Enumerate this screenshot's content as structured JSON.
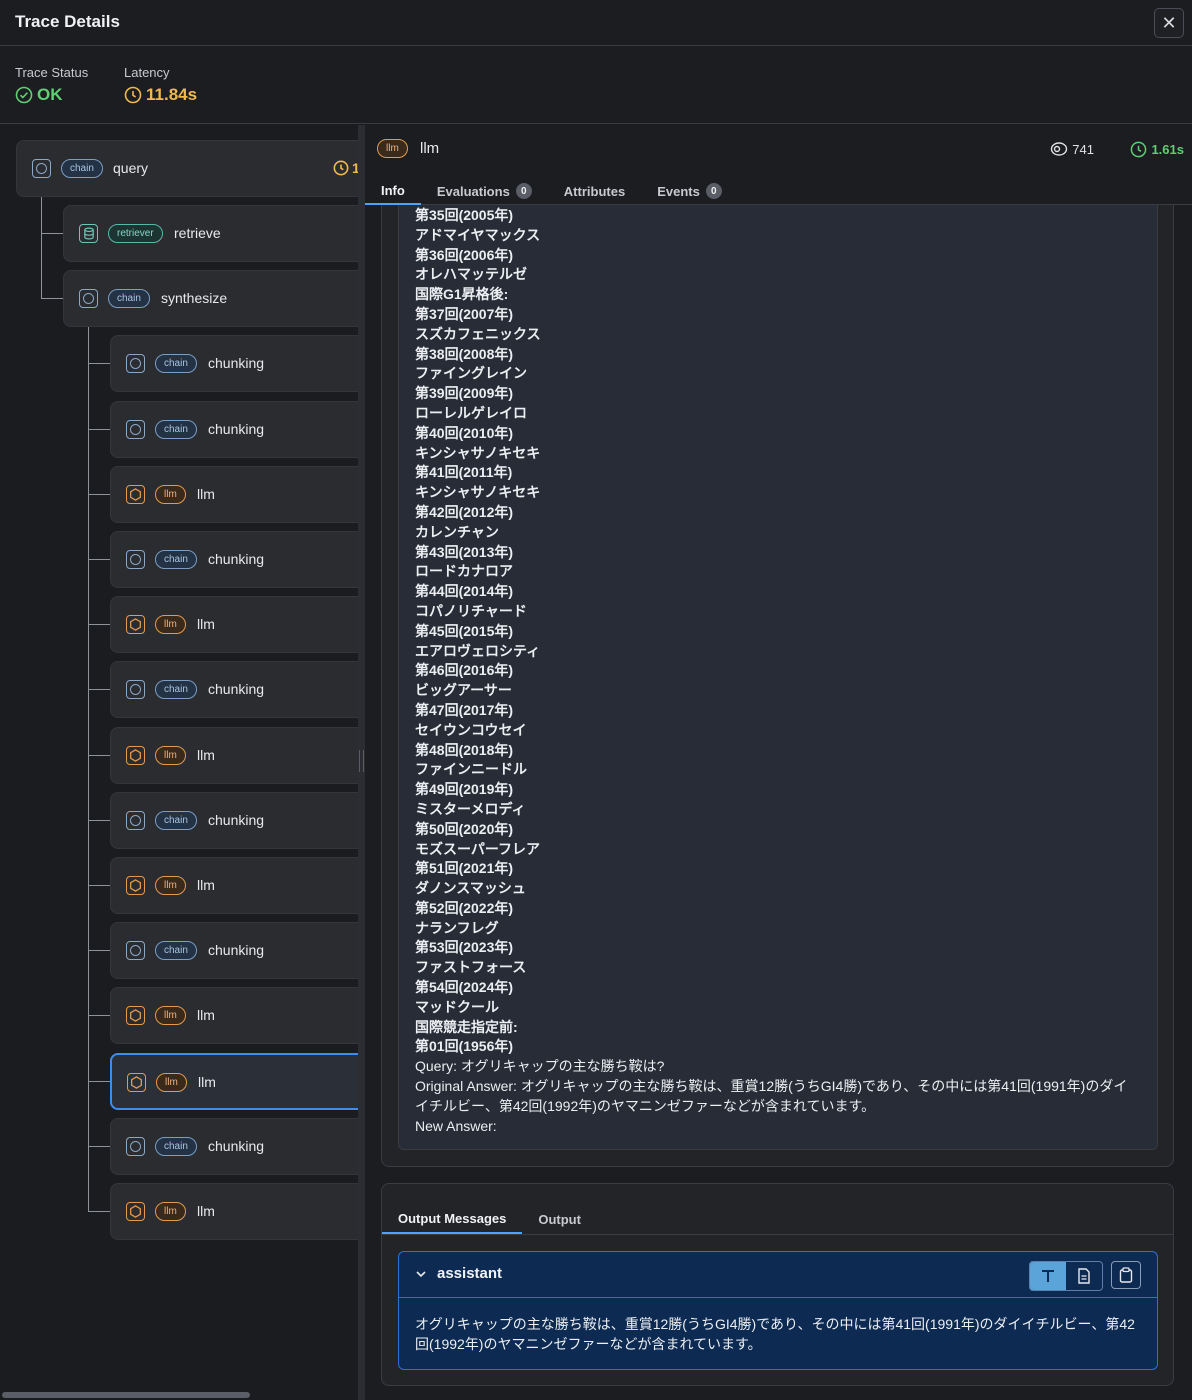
{
  "header": {
    "title": "Trace Details",
    "close_glyph": "✕"
  },
  "status": {
    "trace_status_label": "Trace Status",
    "trace_status_value": "OK",
    "latency_label": "Latency",
    "latency_value": "11.84s"
  },
  "tree": {
    "root": {
      "kind": "chain",
      "name": "query",
      "latency_partial": "1"
    },
    "nodes": [
      {
        "kind": "retriever",
        "name": "retrieve"
      },
      {
        "kind": "chain",
        "name": "synthesize"
      },
      {
        "kind": "chain",
        "name": "chunking"
      },
      {
        "kind": "chain",
        "name": "chunking"
      },
      {
        "kind": "llm",
        "name": "llm"
      },
      {
        "kind": "chain",
        "name": "chunking"
      },
      {
        "kind": "llm",
        "name": "llm"
      },
      {
        "kind": "chain",
        "name": "chunking"
      },
      {
        "kind": "llm",
        "name": "llm"
      },
      {
        "kind": "chain",
        "name": "chunking"
      },
      {
        "kind": "llm",
        "name": "llm"
      },
      {
        "kind": "chain",
        "name": "chunking"
      },
      {
        "kind": "llm",
        "name": "llm"
      },
      {
        "kind": "llm",
        "name": "llm"
      },
      {
        "kind": "chain",
        "name": "chunking"
      },
      {
        "kind": "llm",
        "name": "llm"
      }
    ]
  },
  "span": {
    "kind": "llm",
    "name": "llm",
    "tokens": "741",
    "duration": "1.61s",
    "tabs": [
      {
        "label": "Info",
        "count": null
      },
      {
        "label": "Evaluations",
        "count": "0"
      },
      {
        "label": "Attributes",
        "count": null
      },
      {
        "label": "Events",
        "count": "0"
      }
    ]
  },
  "input_lines": [
    "第35回(2005年)",
    "アドマイヤマックス",
    "第36回(2006年)",
    "オレハマッテルゼ",
    "国際G1昇格後:",
    "第37回(2007年)",
    "スズカフェニックス",
    "第38回(2008年)",
    "ファイングレイン",
    "第39回(2009年)",
    "ローレルゲレイロ",
    "第40回(2010年)",
    "キンシャサノキセキ",
    "第41回(2011年)",
    "キンシャサノキセキ",
    "第42回(2012年)",
    "カレンチャン",
    "第43回(2013年)",
    "ロードカナロア",
    "第44回(2014年)",
    "コパノリチャード",
    "第45回(2015年)",
    "エアロヴェロシティ",
    "第46回(2016年)",
    "ビッグアーサー",
    "第47回(2017年)",
    "セイウンコウセイ",
    "第48回(2018年)",
    "ファインニードル",
    "第49回(2019年)",
    "ミスターメロディ",
    "第50回(2020年)",
    "モズスーパーフレア",
    "第51回(2021年)",
    "ダノンスマッシュ",
    "第52回(2022年)",
    "ナランフレグ",
    "第53回(2023年)",
    "ファストフォース",
    "第54回(2024年)",
    "マッドクール",
    "国際競走指定前:",
    "第01回(1956年)"
  ],
  "input_tail": {
    "query": "Query: オグリキャップの主な勝ち鞍は?",
    "original_answer": "Original Answer: オグリキャップの主な勝ち鞍は、重賞12勝(うちGI4勝)であり、その中には第41回(1991年)のダイイチルビー、第42回(1992年)のヤマニンゼファーなどが含まれています。",
    "new_answer": "New Answer:"
  },
  "output": {
    "tabs": [
      "Output Messages",
      "Output"
    ],
    "role": "assistant",
    "content": "オグリキャップの主な勝ち鞍は、重賞12勝(うちGI4勝)であり、その中には第41回(1991年)のダイイチルビー、第42回(1992年)のヤマニンゼファーなどが含まれています。"
  },
  "colors": {
    "ok": "#5fcf73",
    "latency": "#f0b94e",
    "accent": "#4aa3ff",
    "llm": "#e39a4e",
    "chain": "#8aa8c8",
    "retriever": "#6fc6b7"
  }
}
